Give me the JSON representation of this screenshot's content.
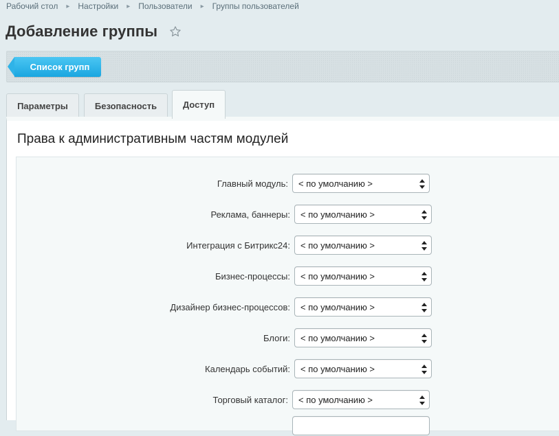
{
  "breadcrumb": [
    "Рабочий стол",
    "Настройки",
    "Пользователи",
    "Группы пользователей"
  ],
  "page": {
    "title": "Добавление группы"
  },
  "toolbar": {
    "list_button": "Список групп"
  },
  "tabs": [
    {
      "label": "Параметры",
      "active": false
    },
    {
      "label": "Безопасность",
      "active": false
    },
    {
      "label": "Доступ",
      "active": true
    }
  ],
  "section": {
    "title": "Права к административным частям модулей"
  },
  "rows": [
    {
      "label": "Главный модуль:",
      "value": "< по умолчанию >"
    },
    {
      "label": "Реклама, баннеры:",
      "value": "< по умолчанию >"
    },
    {
      "label": "Интеграция с Битрикс24:",
      "value": "< по умолчанию >"
    },
    {
      "label": "Бизнес-процессы:",
      "value": "< по умолчанию >"
    },
    {
      "label": "Дизайнер бизнес-процессов:",
      "value": "< по умолчанию >"
    },
    {
      "label": "Блоги:",
      "value": "< по умолчанию >"
    },
    {
      "label": "Календарь событий:",
      "value": "< по умолчанию >"
    },
    {
      "label": "Торговый каталог:",
      "value": "< по умолчанию >"
    },
    {
      "label": "",
      "value": ""
    }
  ],
  "colors": {
    "accent": "#1fa9e1",
    "background": "#e3ecef"
  },
  "icons": {
    "favorite": "star-icon",
    "select": "updown-arrows-icon",
    "separator": "chevron-right-icon"
  }
}
